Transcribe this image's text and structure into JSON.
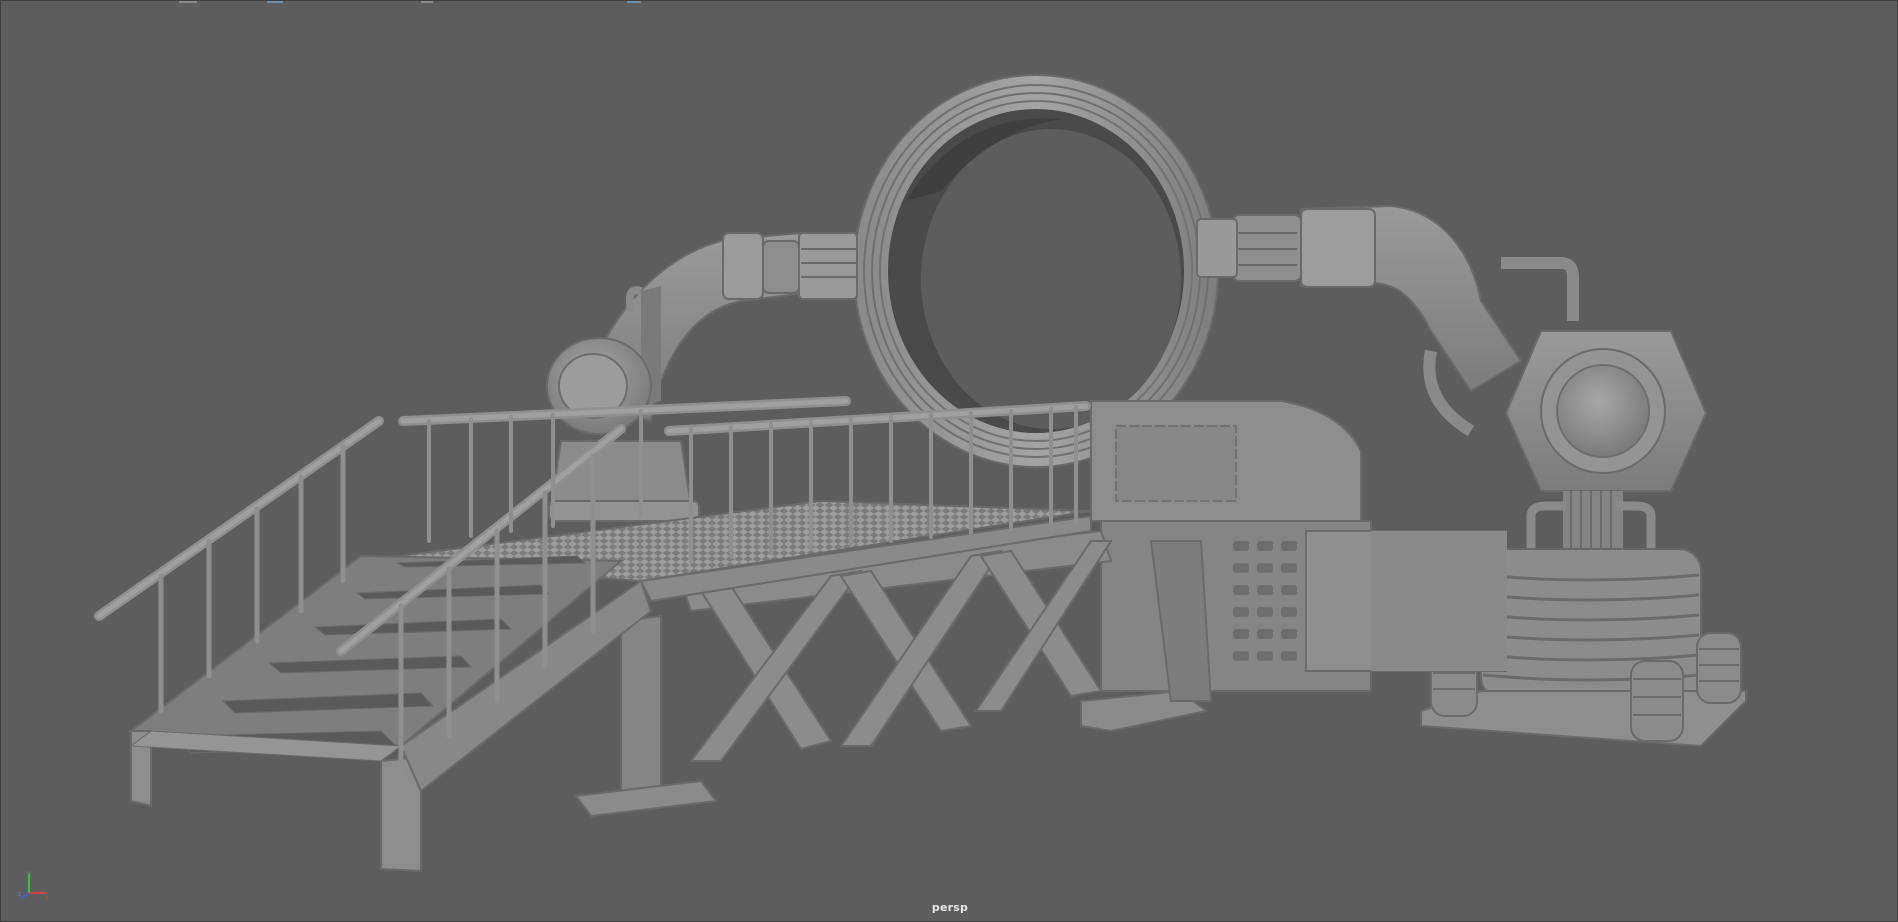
{
  "viewport": {
    "camera_label": "persp",
    "background_color": "#5d5d5d",
    "model_color": "#8c8c8c"
  },
  "axis_gizmo": {
    "icon": "xyz-axis-icon",
    "colors": {
      "x": "#d04040",
      "y": "#40c040",
      "z": "#4060d0"
    }
  }
}
